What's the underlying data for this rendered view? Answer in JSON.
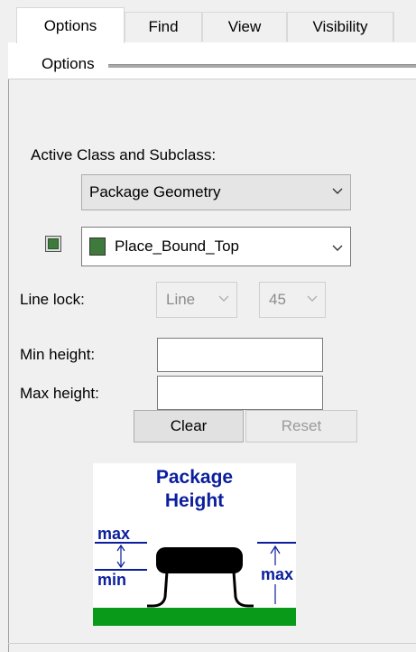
{
  "tabs": [
    {
      "label": "Options",
      "active": true
    },
    {
      "label": "Find",
      "active": false
    },
    {
      "label": "View",
      "active": false
    },
    {
      "label": "Visibility",
      "active": false
    }
  ],
  "group": {
    "title": "Options"
  },
  "active_class": {
    "label": "Active Class and Subclass:",
    "class_value": "Package Geometry",
    "subclass_value": "Place_Bound_Top",
    "subclass_color": "#3d7a3b"
  },
  "line_lock": {
    "label": "Line lock:",
    "type_value": "Line",
    "angle_value": "45"
  },
  "height": {
    "min_label": "Min height:",
    "max_label": "Max height:",
    "min_value": "",
    "max_value": "",
    "clear_label": "Clear",
    "reset_label": "Reset"
  },
  "diagram": {
    "title_line1": "Package",
    "title_line2": "Height",
    "max_label": "max",
    "min_label": "min",
    "right_max_label": "max",
    "title_color": "#0b1e9e",
    "ground_color": "#0a9a1a"
  }
}
